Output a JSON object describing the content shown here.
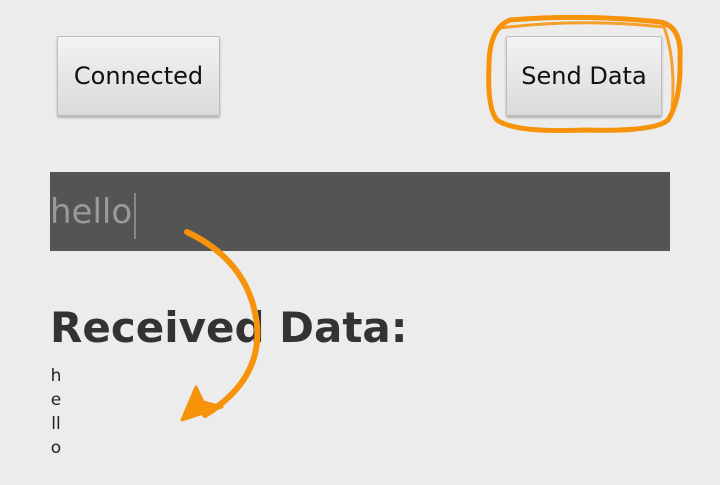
{
  "buttons": {
    "connected_label": "Connected",
    "send_label": "Send Data"
  },
  "input": {
    "value": "hello"
  },
  "received": {
    "label": "Received Data:",
    "text": "hello"
  },
  "colors": {
    "annotation": "#f7930a",
    "input_background": "#545454",
    "page_background": "#ececec"
  }
}
